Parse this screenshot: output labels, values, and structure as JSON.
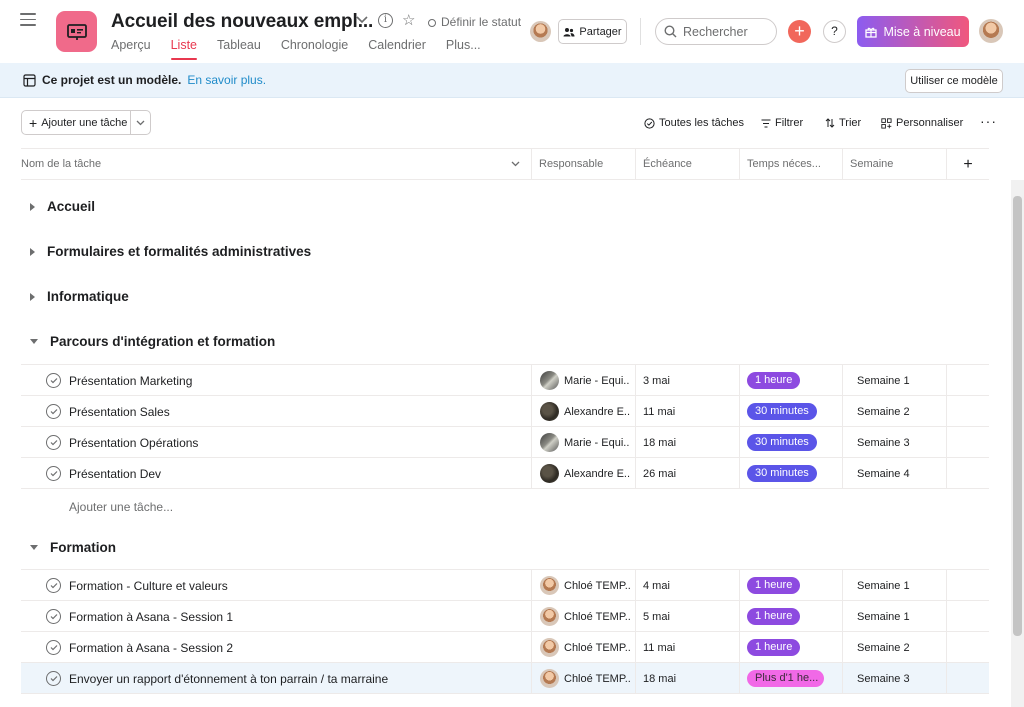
{
  "header": {
    "project_title": "Accueil des nouveaux empl...",
    "status_label": "Définir le statut",
    "share_label": "Partager",
    "search_placeholder": "Rechercher",
    "help_label": "?",
    "upgrade_label": "Mise à niveau",
    "tabs": [
      "Aperçu",
      "Liste",
      "Tableau",
      "Chronologie",
      "Calendrier",
      "Plus..."
    ],
    "active_tab": "Liste"
  },
  "banner": {
    "text": "Ce projet est un modèle.",
    "link": "En savoir plus.",
    "use_template_label": "Utiliser ce modèle"
  },
  "toolbar": {
    "add_task_label": "Ajouter une tâche",
    "all_tasks_label": "Toutes les tâches",
    "filter_label": "Filtrer",
    "sort_label": "Trier",
    "customize_label": "Personnaliser",
    "more_label": "···"
  },
  "columns": [
    "Nom de la tâche",
    "Responsable",
    "Échéance",
    "Temps néces...",
    "Semaine"
  ],
  "sections": [
    {
      "name": "Accueil",
      "expanded": false
    },
    {
      "name": "Formulaires et formalités administratives",
      "expanded": false
    },
    {
      "name": "Informatique",
      "expanded": false
    },
    {
      "name": "Parcours d'intégration et formation",
      "expanded": true
    },
    {
      "name": "Formation",
      "expanded": true
    }
  ],
  "tasks_integration": [
    {
      "name": "Présentation Marketing",
      "assignee": "Marie - Equi...",
      "due": "3 mai",
      "time": "1 heure",
      "week": "Semaine 1"
    },
    {
      "name": "Présentation Sales",
      "assignee": "Alexandre E...",
      "due": "11 mai",
      "time": "30 minutes",
      "week": "Semaine 2"
    },
    {
      "name": "Présentation Opérations",
      "assignee": "Marie - Equi...",
      "due": "18 mai",
      "time": "30 minutes",
      "week": "Semaine 3"
    },
    {
      "name": "Présentation Dev",
      "assignee": "Alexandre E...",
      "due": "26 mai",
      "time": "30 minutes",
      "week": "Semaine 4"
    }
  ],
  "add_task_in_section": "Ajouter une tâche...",
  "tasks_formation": [
    {
      "name": "Formation - Culture et valeurs",
      "assignee": "Chloé TEMP...",
      "due": "4 mai",
      "time": "1 heure",
      "week": "Semaine 1"
    },
    {
      "name": "Formation à Asana - Session 1",
      "assignee": "Chloé TEMP...",
      "due": "5 mai",
      "time": "1 heure",
      "week": "Semaine 1"
    },
    {
      "name": "Formation à Asana - Session 2",
      "assignee": "Chloé TEMP...",
      "due": "11 mai",
      "time": "1 heure",
      "week": "Semaine 2"
    },
    {
      "name": "Envoyer un rapport d'étonnement à ton parrain / ta marraine",
      "assignee": "Chloé TEMP...",
      "due": "18 mai",
      "time": "Plus d'1 he...",
      "week": "Semaine 3"
    }
  ],
  "colors": {
    "accent": "#e8384f",
    "project_icon": "#f06a8a",
    "pill_purple": "#8d4ae0",
    "pill_blue": "#5b55e8",
    "pill_pink": "#f169e7"
  }
}
